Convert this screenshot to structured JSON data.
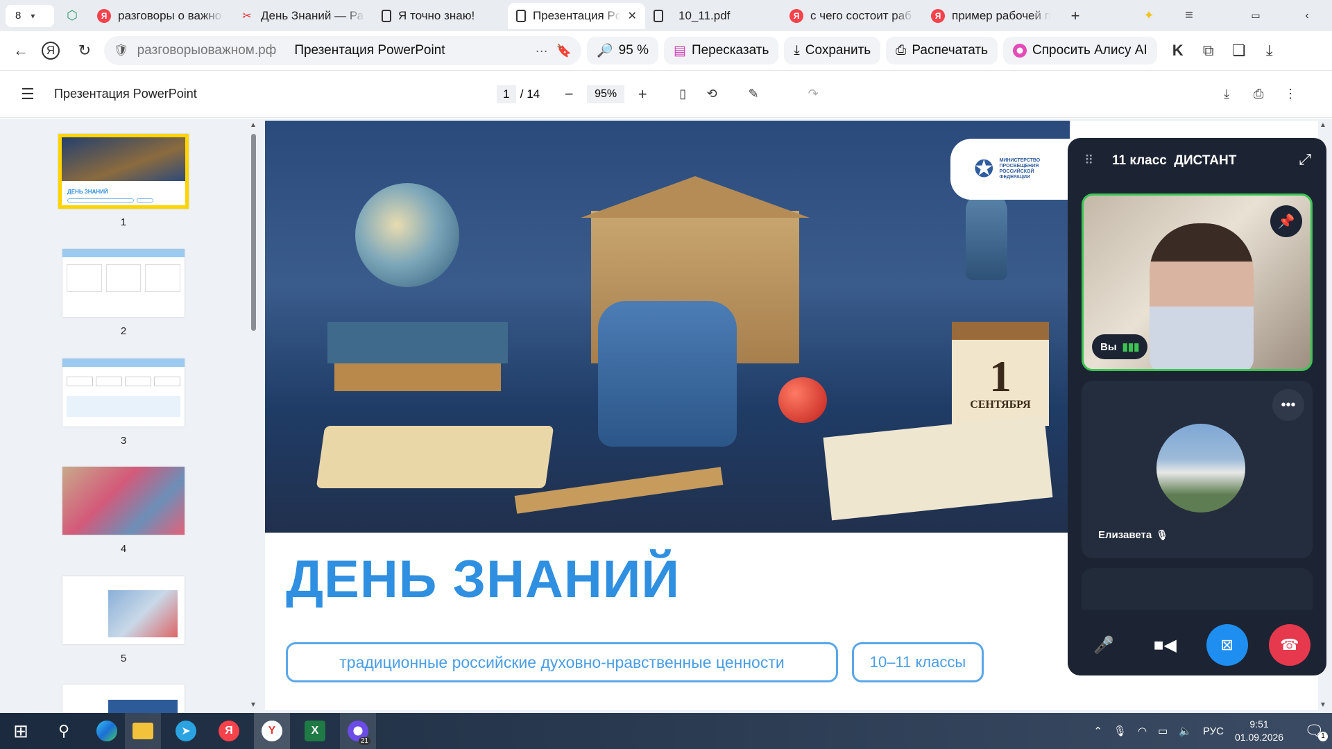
{
  "browser": {
    "tab_count": "8",
    "tabs": [
      {
        "title": "разговоры о важно",
        "icon": "yandex-icon"
      },
      {
        "title": "День Знаний — Ра",
        "icon": "bow-icon"
      },
      {
        "title": "Я точно знаю!",
        "icon": "document-icon"
      },
      {
        "title": "Презентация Po",
        "icon": "document-icon",
        "active": true
      },
      {
        "title": "10_11.pdf",
        "icon": "document-icon"
      },
      {
        "title": "с чего состоит раб",
        "icon": "yandex-icon"
      },
      {
        "title": "пример рабочей пр",
        "icon": "yandex-icon"
      }
    ],
    "url_domain": "разговорыоважном.рф",
    "page_title": "Презентация PowerPoint",
    "zoom_pill": "95 %",
    "retell_label": "Пересказать",
    "save_label": "Сохранить",
    "print_label": "Распечатать",
    "alice_label": "Спросить Алису AI"
  },
  "pdf": {
    "title": "Презентация PowerPoint",
    "current_page": "1",
    "total_pages": "/ 14",
    "zoom": "95%",
    "thumb_numbers": [
      "1",
      "2",
      "3",
      "4",
      "5"
    ]
  },
  "slide": {
    "heading": "ДЕНЬ ЗНАНИЙ",
    "subtitle": "традиционные российские духовно-нравственные ценности",
    "grade_badge": "10–11 классы",
    "ministry_label": "МИНИСТЕРСТВО ПРОСВЕЩЕНИЯ РОССИЙСКОЙ ФЕДЕРАЦИИ",
    "calendar_day": "1",
    "calendar_month": "СЕНТЯБРЯ"
  },
  "call": {
    "title": "11 класс  ДИСТАНТ",
    "you_label": "Вы",
    "participant_name": "Елизавета"
  },
  "taskbar": {
    "language": "РУС",
    "time": "9:51",
    "date": "01.09.2026",
    "notification_count": "1",
    "app_badge": "21"
  },
  "colors": {
    "accent_blue": "#2f8fe0",
    "active_speaker": "#3cc453",
    "hangup": "#e6394d",
    "call_bg": "#1c2433",
    "thumb_selected": "#ffd400"
  }
}
